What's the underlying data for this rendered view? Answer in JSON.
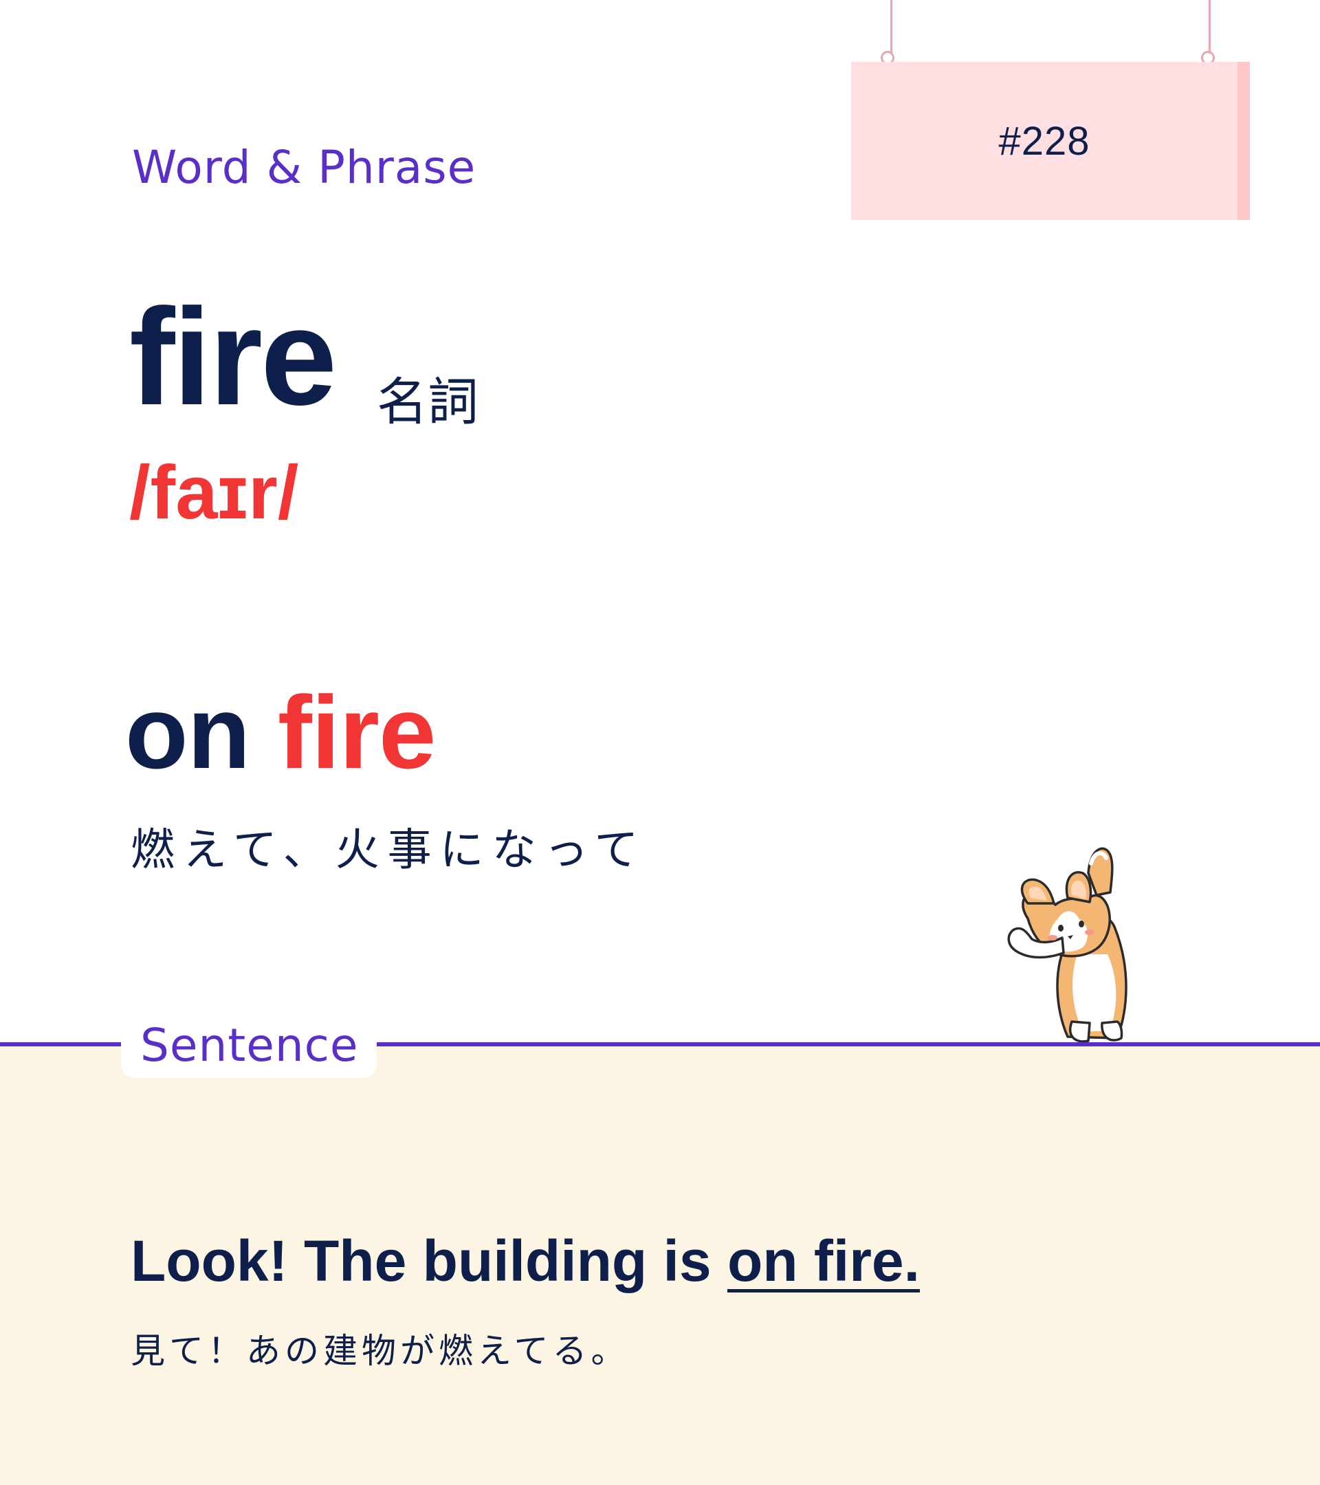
{
  "sign": {
    "number": "#228"
  },
  "category": "Word & Phrase",
  "word": {
    "headword": "fire",
    "part_of_speech": "名詞",
    "ipa": "/faɪr/"
  },
  "phrase": {
    "prefix": "on ",
    "highlight": "fire",
    "translation": "燃えて、火事になって"
  },
  "section": {
    "label": "Sentence"
  },
  "sentence": {
    "prefix": "Look! The building is ",
    "highlight": "on fire.",
    "translation": "見て！あの建物が燃えてる。"
  },
  "colors": {
    "navy": "#0d1f4a",
    "accent_red": "#f23535",
    "purple": "#5a2ec9",
    "sign_pink": "#ffdfe2",
    "panel_cream": "#fdf5e3"
  }
}
